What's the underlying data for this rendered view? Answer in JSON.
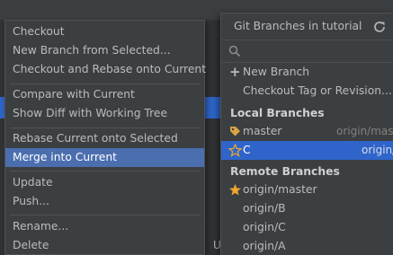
{
  "context_menu": {
    "items": [
      {
        "label": "Checkout"
      },
      {
        "label": "New Branch from Selected..."
      },
      {
        "label": "Checkout and Rebase onto Current"
      },
      {
        "label": "Compare with Current"
      },
      {
        "label": "Show Diff with Working Tree"
      },
      {
        "label": "Rebase Current onto Selected"
      },
      {
        "label": "Merge into Current"
      },
      {
        "label": "Update"
      },
      {
        "label": "Push..."
      },
      {
        "label": "Rename..."
      },
      {
        "label": "Delete"
      }
    ],
    "selected_item": "Merge into Current"
  },
  "background": {
    "partial_text": "U"
  },
  "branches_popup": {
    "title": "Git Branches in tutorial",
    "search": {
      "value": "",
      "placeholder": ""
    },
    "actions": [
      {
        "label": "New Branch",
        "icon": "plus-icon"
      },
      {
        "label": "Checkout Tag or Revision..."
      }
    ],
    "local_header": "Local Branches",
    "local": [
      {
        "label": "master",
        "tracking": "origin/master",
        "icon": "tag-icon"
      },
      {
        "label": "C",
        "tracking": "origin/C",
        "icon": "star-outline-icon",
        "selected": true
      }
    ],
    "remote_header": "Remote Branches",
    "remote": [
      {
        "label": "origin/master",
        "icon": "star-icon"
      },
      {
        "label": "origin/B"
      },
      {
        "label": "origin/C"
      },
      {
        "label": "origin/A"
      }
    ]
  },
  "colors": {
    "menu_bg": "#3c3f41",
    "selection": "#4b6eaf",
    "popup_selection": "#2f65ca",
    "text": "#bbbbbb",
    "tag": "#d9a343",
    "star": "#f0a732"
  }
}
